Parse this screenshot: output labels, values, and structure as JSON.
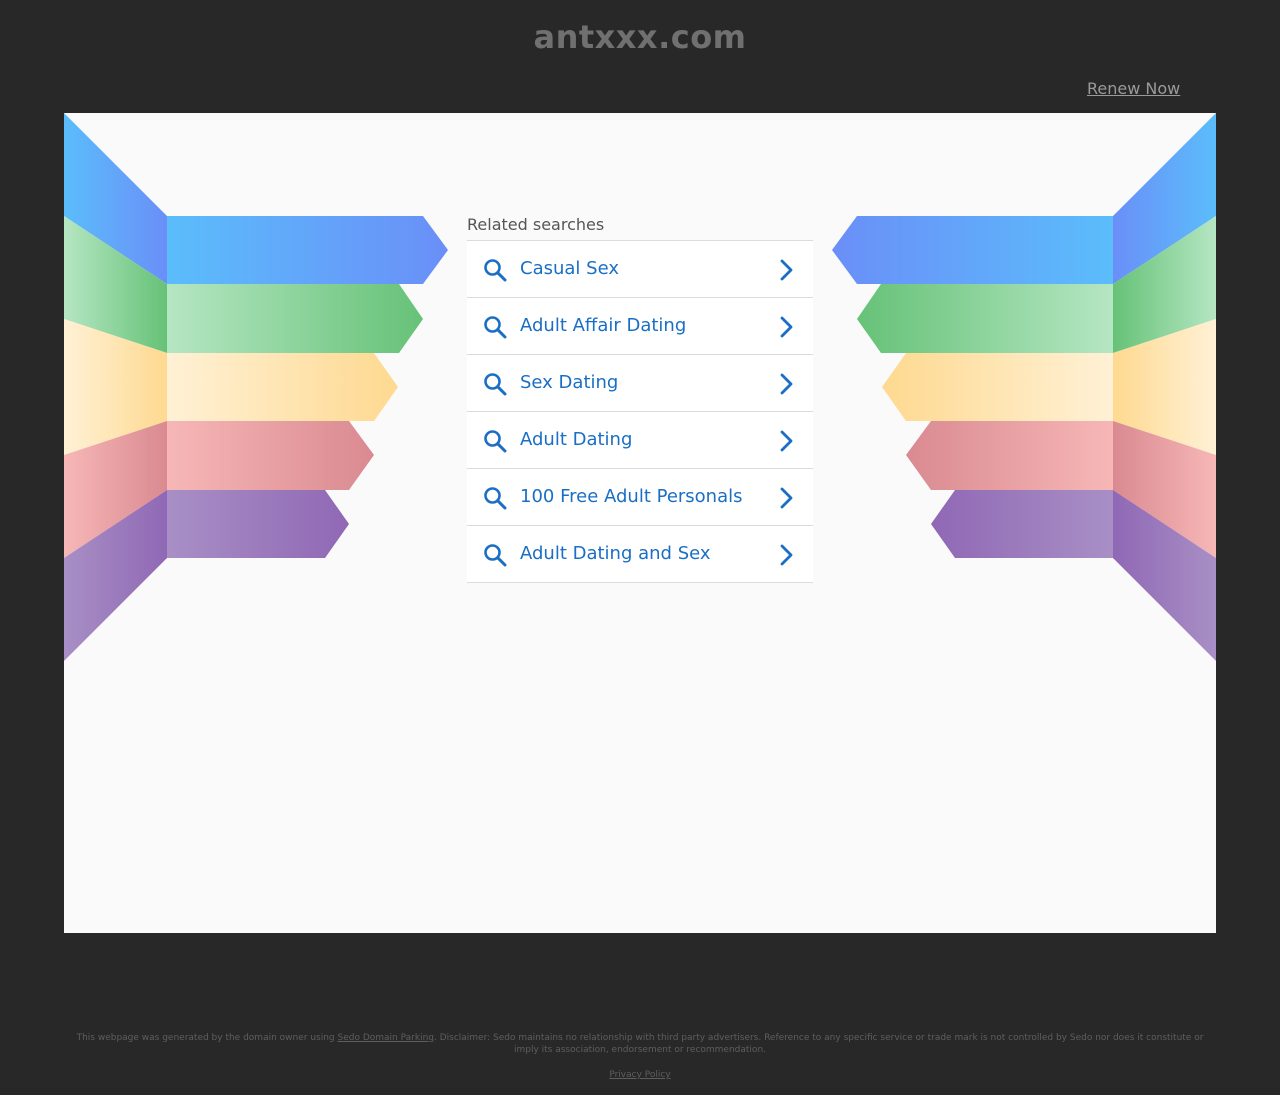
{
  "header": {
    "domain": "antxxx.com",
    "renew_label": "Renew Now"
  },
  "searches": {
    "heading": "Related searches",
    "items": [
      {
        "label": "Casual Sex"
      },
      {
        "label": "Adult Affair Dating"
      },
      {
        "label": "Sex Dating"
      },
      {
        "label": "Adult Dating"
      },
      {
        "label": "100 Free Adult Personals"
      },
      {
        "label": "Adult Dating and Sex"
      }
    ]
  },
  "footer": {
    "text_before": "This webpage was generated by the domain owner using ",
    "link_label": "Sedo Domain Parking",
    "text_after": ". Disclaimer: Sedo maintains no relationship with third party advertisers. Reference to any specific service or trade mark is not controlled by Sedo nor does it constitute or imply its association, endorsement or recommendation.",
    "privacy_label": "Privacy Policy"
  },
  "colors": {
    "blue": "#5fb8f8",
    "green": "#6cc47e",
    "yellow": "#fde3a2",
    "red": "#e59898",
    "purple": "#9c7cbb",
    "link": "#1a6fc4"
  },
  "icons": [
    "search-icon",
    "chevron-right-icon"
  ]
}
